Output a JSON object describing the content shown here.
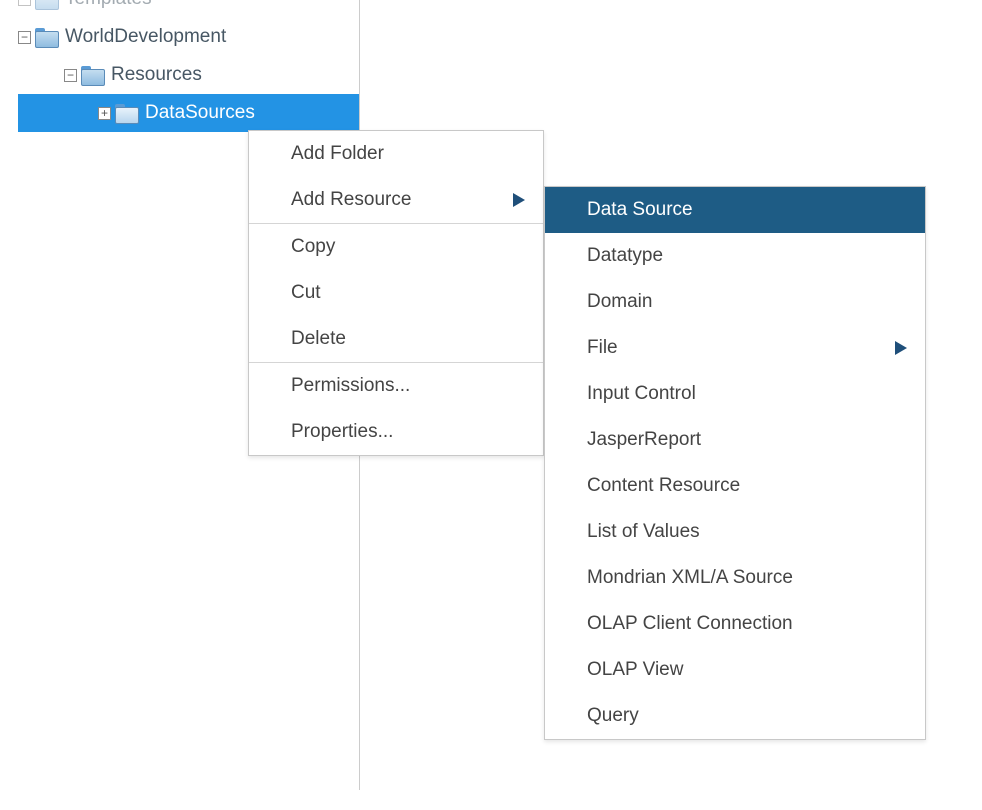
{
  "tree": {
    "nodes": [
      {
        "label": "Templates",
        "level": 0,
        "expand": "minus",
        "partial": true
      },
      {
        "label": "WorldDevelopment",
        "level": 0,
        "expand": "minus"
      },
      {
        "label": "Resources",
        "level": 1,
        "expand": "minus"
      },
      {
        "label": "DataSources",
        "level": 2,
        "expand": "plus",
        "selected": true
      }
    ]
  },
  "contextMenu": {
    "groups": [
      [
        {
          "label": "Add Folder"
        },
        {
          "label": "Add Resource",
          "hasSubmenu": true,
          "hovered": true
        }
      ],
      [
        {
          "label": "Copy"
        },
        {
          "label": "Cut"
        },
        {
          "label": "Delete"
        }
      ],
      [
        {
          "label": "Permissions..."
        },
        {
          "label": "Properties..."
        }
      ]
    ]
  },
  "submenu": {
    "items": [
      {
        "label": "Data Source",
        "selected": true
      },
      {
        "label": "Datatype"
      },
      {
        "label": "Domain"
      },
      {
        "label": "File",
        "hasSubmenu": true
      },
      {
        "label": "Input Control"
      },
      {
        "label": "JasperReport"
      },
      {
        "label": "Content Resource"
      },
      {
        "label": "List of Values"
      },
      {
        "label": "Mondrian XML/A Source"
      },
      {
        "label": "OLAP Client Connection"
      },
      {
        "label": "OLAP View"
      },
      {
        "label": "Query"
      }
    ]
  }
}
